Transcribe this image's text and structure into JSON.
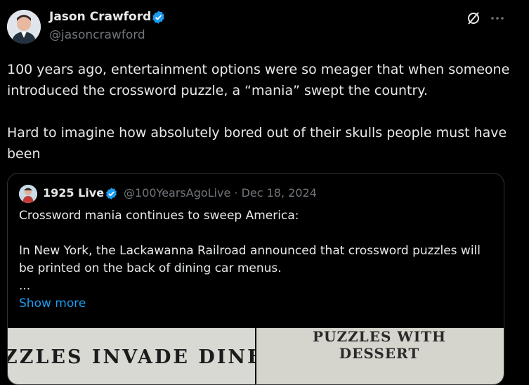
{
  "author": {
    "name": "Jason Crawford",
    "handle": "@jasoncrawford",
    "verified_color": "#1d9bf0"
  },
  "actions": {
    "grok_icon": "grok-icon",
    "more_icon": "more-dots-icon"
  },
  "tweet": {
    "text": "100 years ago, entertainment options were so meager that when someone introduced the crossword puzzle, a “mania” swept the country.\n\nHard to imagine how absolutely bored out of their skulls people must have been"
  },
  "quote": {
    "name": "1925 Live",
    "meta": "@100YearsAgoLive · Dec 18, 2024",
    "text": "Crossword mania continues to sweep America:\n\nIn New York, the Lackawanna Railroad announced that crossword puzzles will be printed on the back of dining car menus.\n...",
    "show_more": "Show more",
    "media": {
      "left_headline": "ZZLES INVADE DINE",
      "right_headline": "PUZZLES WITH\nDESSERT"
    }
  },
  "colors": {
    "link": "#1d9bf0",
    "muted": "#71767b",
    "text": "#e7e9ea",
    "border": "#2f3336"
  }
}
